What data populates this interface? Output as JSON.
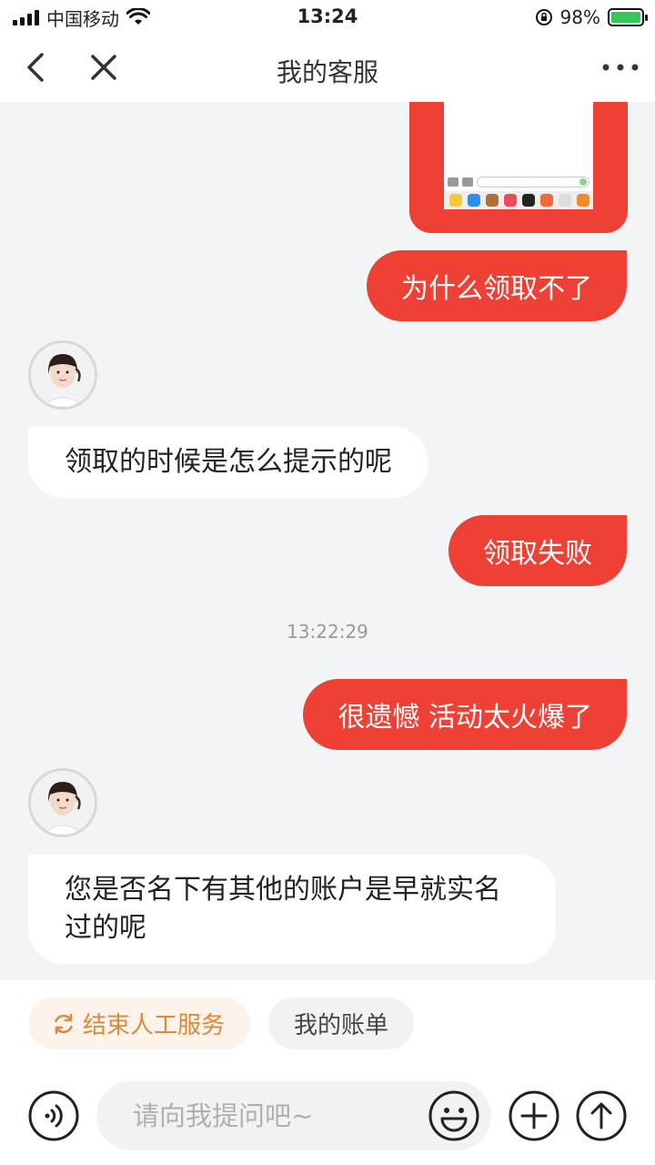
{
  "status_bar": {
    "carrier": "中国移动",
    "time": "13:24",
    "battery": "98%",
    "icons": [
      "signal-icon",
      "wifi-icon",
      "orientation-lock-icon",
      "battery-icon"
    ]
  },
  "nav": {
    "title": "我的客服",
    "icons": [
      "back-icon",
      "close-icon",
      "more-icon"
    ]
  },
  "messages": [
    {
      "side": "right",
      "type": "image"
    },
    {
      "side": "right",
      "type": "text",
      "text": "为什么领取不了"
    },
    {
      "side": "left",
      "type": "text",
      "text": "领取的时候是怎么提示的呢"
    },
    {
      "side": "right",
      "type": "text",
      "text": "领取失败"
    },
    {
      "side": "right",
      "type": "text",
      "text": "很遗憾 活动太火爆了"
    },
    {
      "side": "left",
      "type": "text",
      "text": "您是否名下有其他的账户是早就实名过的呢"
    }
  ],
  "timestamp": "13:22:29",
  "quick_actions": [
    {
      "label": "结束人工服务",
      "icon": "refresh-icon"
    },
    {
      "label": "我的账单"
    }
  ],
  "composer": {
    "placeholder": "请向我提问吧~",
    "value": "",
    "icons": [
      "voice-icon",
      "emoji-icon",
      "plus-icon",
      "send-up-icon"
    ]
  },
  "colors": {
    "accent": "#ee4035",
    "chip_end_text": "#d98a3c",
    "chip_end_bg": "#fdf3ea",
    "background": "#f3f4f6"
  }
}
